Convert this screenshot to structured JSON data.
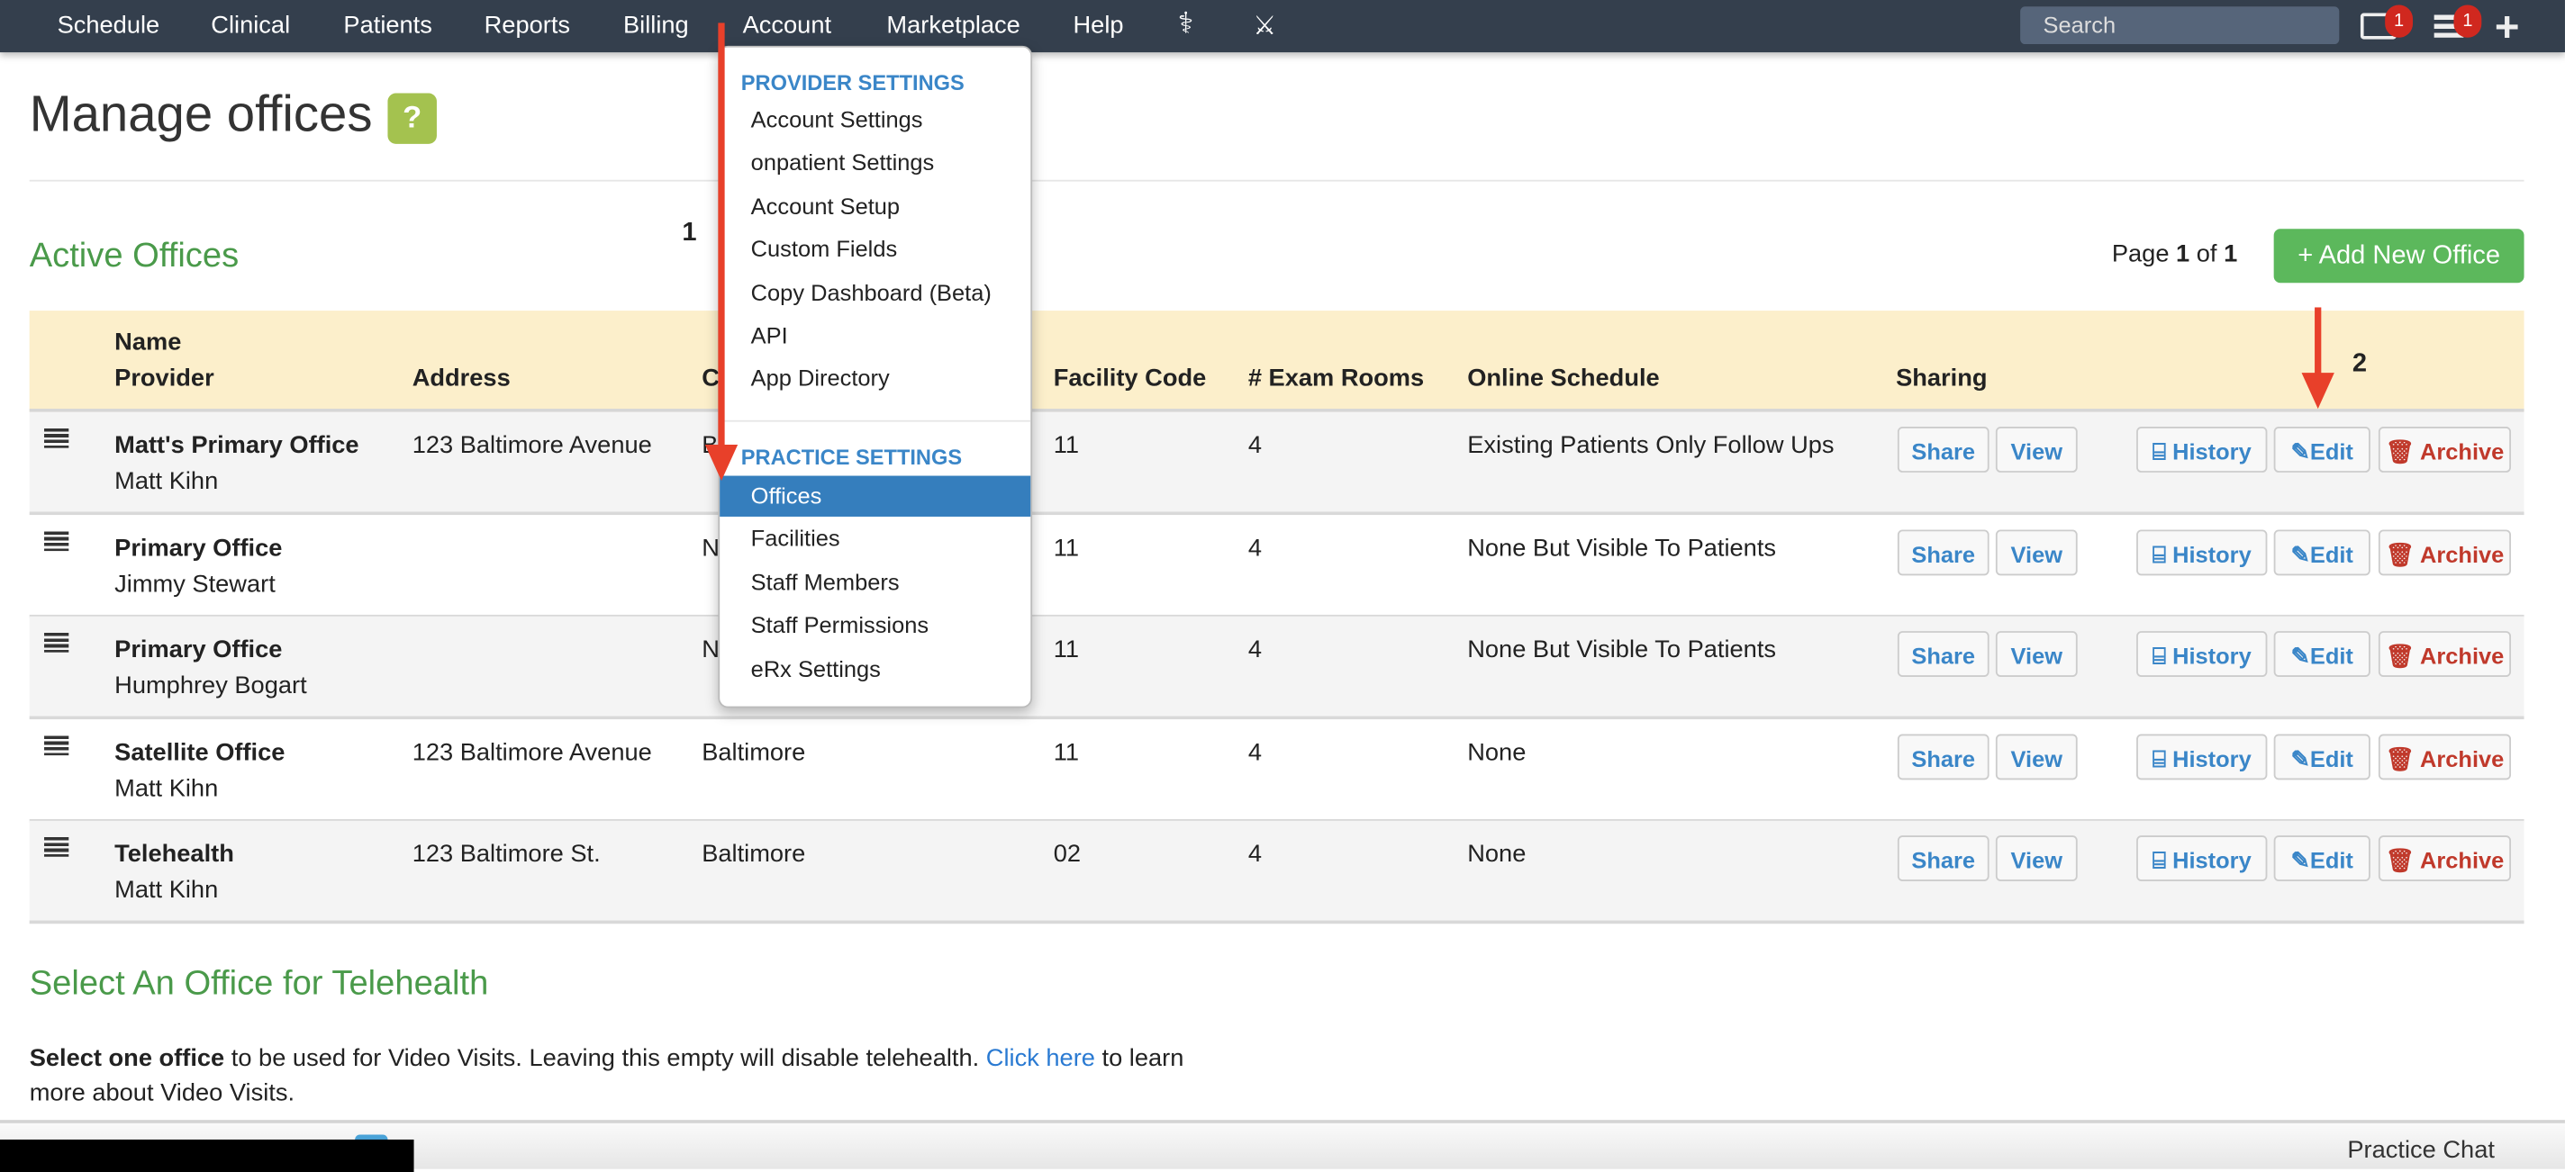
{
  "nav": {
    "items": [
      "Schedule",
      "Clinical",
      "Patients",
      "Reports",
      "Billing",
      "Account",
      "Marketplace",
      "Help"
    ],
    "icons": [
      "caduceus-icon",
      "scissors-icon"
    ],
    "search_placeholder": "Search",
    "messages_badge": "1",
    "tasks_badge": "1"
  },
  "page": {
    "title": "Manage offices",
    "help_label": "?",
    "section_title": "Active Offices",
    "pagination": {
      "prefix": "Page ",
      "current": "1",
      "mid": " of ",
      "total": "1"
    },
    "add_button": "+ Add New Office"
  },
  "table": {
    "headers": {
      "name": "Name",
      "provider": "Provider",
      "address": "Address",
      "city": "C",
      "facility_code": "Facility Code",
      "exam_rooms": "# Exam Rooms",
      "online_schedule": "Online Schedule",
      "sharing": "Sharing"
    },
    "rows": [
      {
        "name": "Matt's Primary Office",
        "provider": "Matt Kihn",
        "address": "123 Baltimore Avenue",
        "city": "B",
        "facility_code": "11",
        "exam_rooms": "4",
        "online_schedule": "Existing Patients Only Follow Ups"
      },
      {
        "name": "Primary Office",
        "provider": "Jimmy Stewart",
        "address": "",
        "city": "N",
        "facility_code": "11",
        "exam_rooms": "4",
        "online_schedule": "None But Visible To Patients"
      },
      {
        "name": "Primary Office",
        "provider": "Humphrey Bogart",
        "address": "",
        "city": "N",
        "facility_code": "11",
        "exam_rooms": "4",
        "online_schedule": "None But Visible To Patients"
      },
      {
        "name": "Satellite Office",
        "provider": "Matt Kihn",
        "address": "123 Baltimore Avenue",
        "city": "Baltimore",
        "facility_code": "11",
        "exam_rooms": "4",
        "online_schedule": "None"
      },
      {
        "name": "Telehealth",
        "provider": "Matt Kihn",
        "address": "123 Baltimore St.",
        "city": "Baltimore",
        "facility_code": "02",
        "exam_rooms": "4",
        "online_schedule": "None"
      }
    ],
    "buttons": {
      "share": "Share",
      "view": "View",
      "history": "History",
      "edit": "Edit",
      "archive": "Archive"
    }
  },
  "dropdown": {
    "provider_header": "PROVIDER SETTINGS",
    "provider_items": [
      "Account Settings",
      "onpatient Settings",
      "Account Setup",
      "Custom Fields",
      "Copy Dashboard (Beta)",
      "API",
      "App Directory"
    ],
    "practice_header": "PRACTICE SETTINGS",
    "practice_items": [
      "Offices",
      "Facilities",
      "Staff Members",
      "Staff Permissions",
      "eRx Settings"
    ],
    "active_item": "Offices"
  },
  "annotations": {
    "step1": "1",
    "step2": "2"
  },
  "telehealth": {
    "title": "Select An Office for Telehealth",
    "bold": "Select one office",
    "text": " to be used for Video Visits. Leaving this empty will disable telehealth. ",
    "link": "Click here",
    "text2": " to learn more about Video Visits."
  },
  "footer": {
    "chat": "Practice Chat"
  },
  "colors": {
    "nav_bg": "#343f4d",
    "accent_green": "#4a9a4a",
    "button_green": "#5cb85c",
    "link_blue": "#3a86c8",
    "danger_red": "#c0392b",
    "annotation_red": "#e8402a",
    "header_bg": "#fcefcb"
  }
}
